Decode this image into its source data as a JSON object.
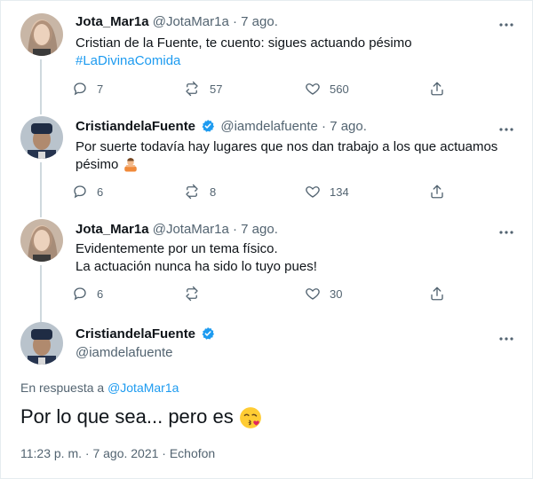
{
  "tweets": [
    {
      "name": "Jota_Mar1a",
      "handle": "@JotaMar1a",
      "separator": "·",
      "date": "7 ago.",
      "line1": "Cristian de la Fuente, te cuento: sigues actuando pésimo",
      "hashtag": "#LaDivinaComida",
      "replies": "7",
      "retweets": "57",
      "likes": "560"
    },
    {
      "name": "CristiandelaFuente",
      "handle": "@iamdelafuente",
      "separator": "·",
      "date": "7 ago.",
      "line1": "Por suerte todavía hay lugares que nos dan trabajo a los que actuamos",
      "line2": "pésimo",
      "emoji": "man-gesturing-emoji",
      "replies": "6",
      "retweets": "8",
      "likes": "134"
    },
    {
      "name": "Jota_Mar1a",
      "handle": "@JotaMar1a",
      "separator": "·",
      "date": "7 ago.",
      "line1": "Evidentemente por un tema físico.",
      "line2": "La actuación nunca ha sido lo tuyo pues!",
      "replies": "6",
      "retweets": "",
      "likes": "30"
    }
  ],
  "main": {
    "name": "CristiandelaFuente",
    "handle": "@iamdelafuente",
    "reply_prefix": "En respuesta a",
    "reply_handle": "@JotaMar1a",
    "text": "Por lo que sea... pero es",
    "emoji": "kissing-face-emoji",
    "meta": "11:23 p. m. · 7 ago. 2021 · Echofon"
  },
  "icons": {
    "reply": "reply-icon",
    "retweet": "retweet-icon",
    "like": "heart-icon",
    "share": "share-icon",
    "more": "more-icon",
    "verified": "verified-badge-icon"
  },
  "colors": {
    "link": "#1d9bf0",
    "secondary": "#536471",
    "thread_line": "#cfd9de"
  }
}
